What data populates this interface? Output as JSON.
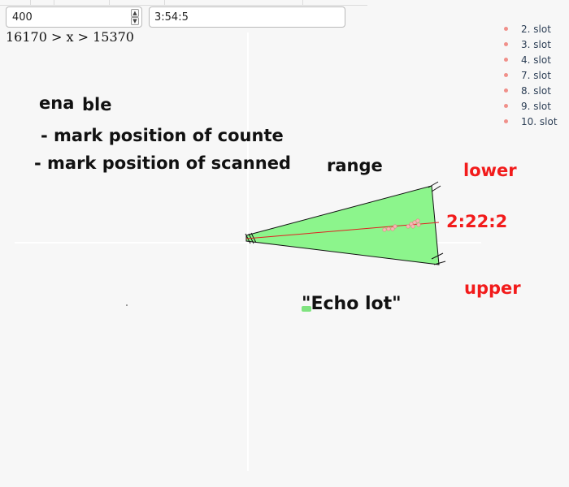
{
  "inputs": {
    "number_value": "400",
    "time_value": "3:54:5"
  },
  "range_text": "16170 > x > 15370",
  "slots": [
    "2. slot",
    "3. slot",
    "4. slot",
    "7. slot",
    "8. slot",
    "9. slot",
    "10. slot"
  ],
  "annotations": {
    "enable_part1": "ena",
    "enable_part2": "ble",
    "mark_counter": "- mark position of counte",
    "mark_scanned": "- mark position of scanned",
    "range_word": "range",
    "lower": "lower",
    "upper": "upper",
    "time_marker": "2:22:2",
    "echo_label": "\"Echo lot\""
  },
  "colors": {
    "cone_fill": "#8cf58c",
    "centerline": "#e02020",
    "slot_dot": "#f0908a",
    "label_red": "#f21b1b"
  }
}
